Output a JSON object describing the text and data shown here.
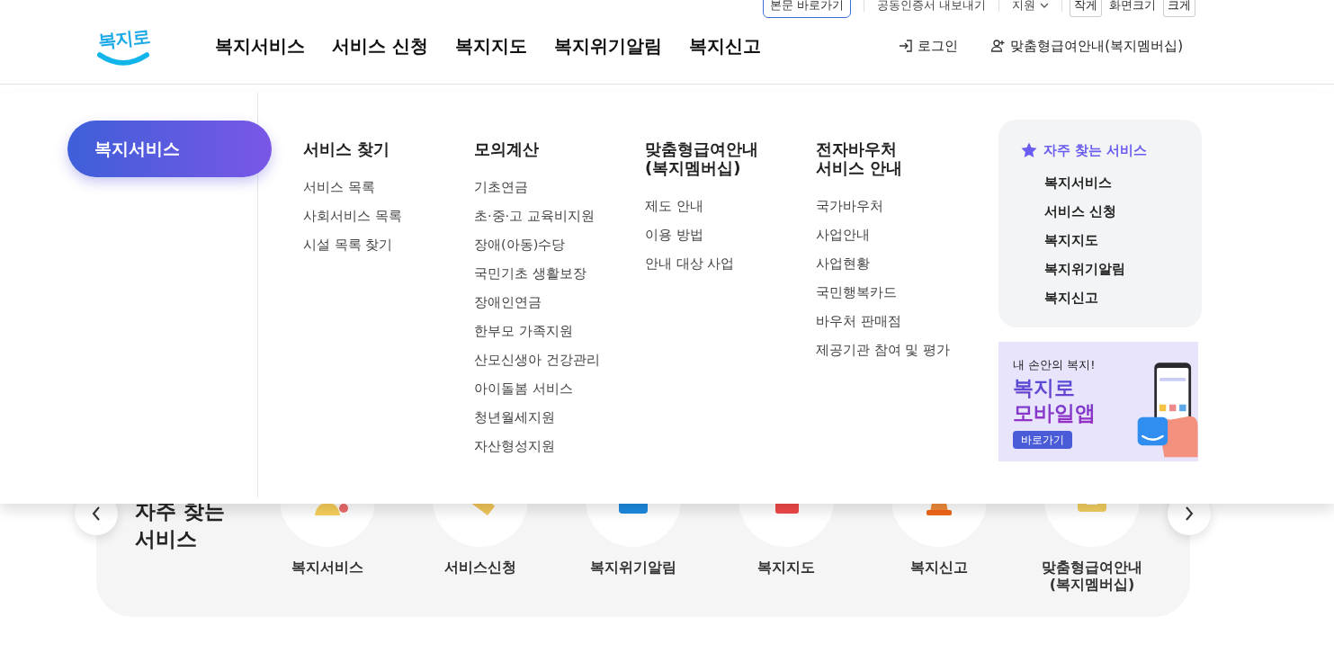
{
  "utility": [
    {
      "label": "본문 바로가기",
      "kind": "skip"
    },
    {
      "label": "공동인증서 내보내기",
      "kind": "link"
    },
    {
      "label": "지원",
      "kind": "dropdown"
    }
  ],
  "font_size": [
    {
      "label": "작게",
      "kind": "button"
    },
    {
      "label": "화면크기",
      "kind": "label"
    },
    {
      "label": "크게",
      "kind": "button"
    }
  ],
  "logo": "복지로",
  "nav": [
    "복지서비스",
    "서비스 신청",
    "복지지도",
    "복지위기알림",
    "복지신고"
  ],
  "account": [
    {
      "label": "로그인",
      "kind": "login"
    },
    {
      "label": "맞춤형급여안내(복지멤버십)",
      "kind": "member"
    }
  ],
  "mega_menu": {
    "category": "복지서비스",
    "columns": [
      {
        "title": "서비스 찾기",
        "items": [
          "서비스 목록",
          "사회서비스 목록",
          "시설 목록 찾기"
        ]
      },
      {
        "title": "모의계산",
        "items": [
          "기초연금",
          "초·중·고 교육비지원",
          "장애(아동)수당",
          "국민기초 생활보장",
          "장애인연금",
          "한부모 가족지원",
          "산모신생아 건강관리",
          "아이돌봄 서비스",
          "청년월세지원",
          "자산형성지원"
        ]
      },
      {
        "title": "맞춤형급여안내\n(복지멤버십)",
        "items": [
          "제도 안내",
          "이용 방법",
          "안내 대상 사업"
        ]
      },
      {
        "title": "전자바우처\n서비스 안내",
        "items": [
          "국가바우처",
          "사업안내",
          "사업현황",
          "국민행복카드",
          "바우처 판매점",
          "제공기관 참여 및 평가"
        ]
      }
    ],
    "favorites": {
      "title": "자주 찾는 서비스",
      "items": [
        "복지서비스",
        "서비스 신청",
        "복지지도",
        "복지위기알림",
        "복지신고"
      ]
    },
    "banner": {
      "tagline": "내 손안의 복지!",
      "title_lines": [
        "복지로",
        "모바일앱"
      ],
      "button": "바로가기"
    }
  },
  "favorites_section": {
    "title_lines": [
      "자주 찾는",
      "서비스"
    ],
    "items": [
      {
        "label": "복지서비스",
        "kind": "person"
      },
      {
        "label": "서비스신청",
        "kind": "hand"
      },
      {
        "label": "복지위기알림",
        "kind": "card"
      },
      {
        "label": "복지지도",
        "kind": "map"
      },
      {
        "label": "복지신고",
        "kind": "cone"
      },
      {
        "label": "맞춤형급여안내\n(복지멤버십)",
        "kind": "id"
      }
    ]
  }
}
